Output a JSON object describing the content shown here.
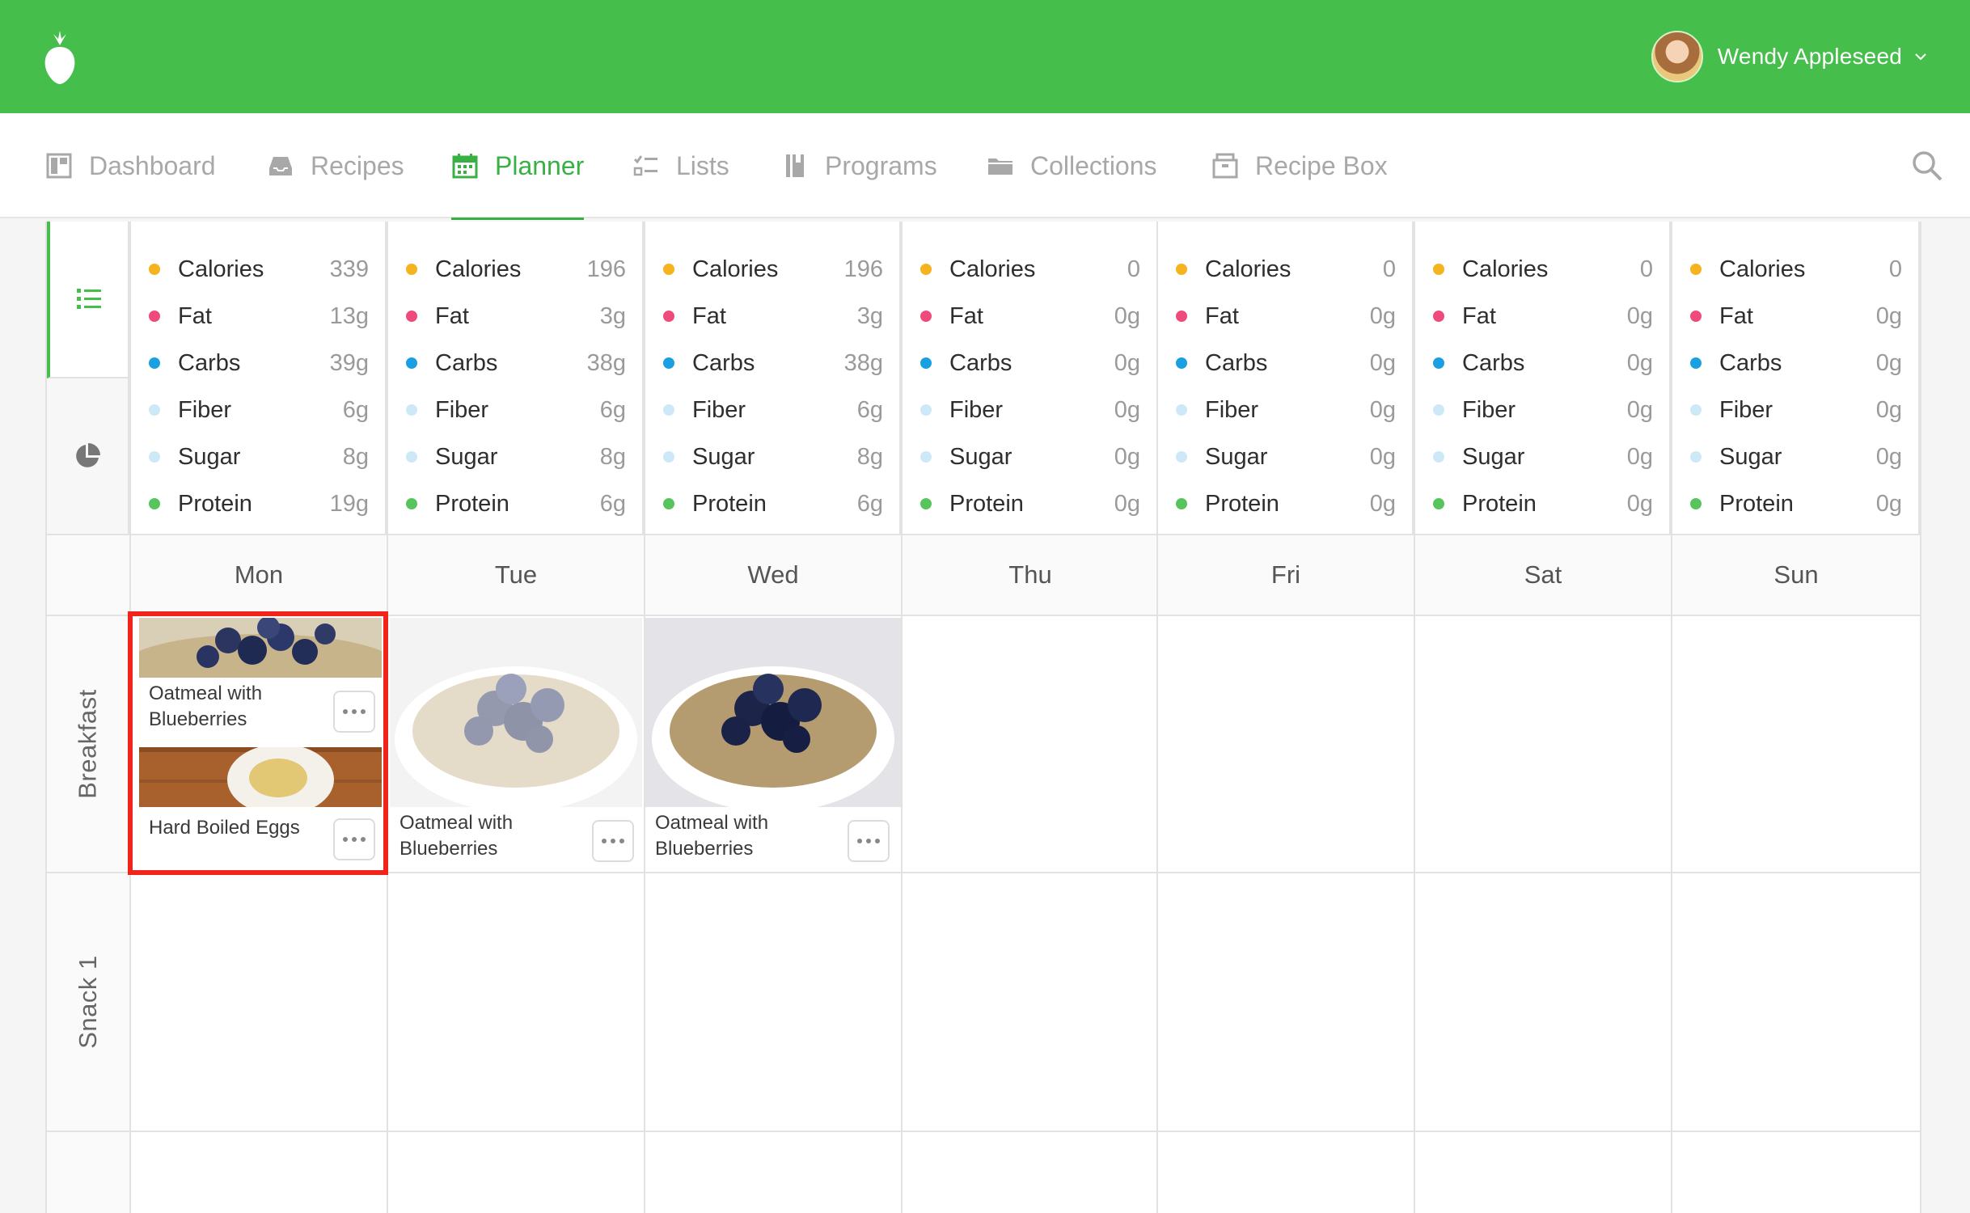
{
  "header": {
    "user_name": "Wendy Appleseed",
    "accent": "#45be4b",
    "logo_icon": "strawberry-logo-icon",
    "avatar_icon": "user-avatar"
  },
  "nav": {
    "items": [
      {
        "label": "Dashboard",
        "icon": "dashboard-icon"
      },
      {
        "label": "Recipes",
        "icon": "tray-icon"
      },
      {
        "label": "Planner",
        "icon": "calendar-icon",
        "active": true
      },
      {
        "label": "Lists",
        "icon": "checklist-icon"
      },
      {
        "label": "Programs",
        "icon": "book-icon"
      },
      {
        "label": "Collections",
        "icon": "folder-icon"
      },
      {
        "label": "Recipe Box",
        "icon": "box-icon"
      }
    ],
    "search_icon": "search-icon"
  },
  "side_tabs": [
    {
      "icon": "list-icon",
      "active": true
    },
    {
      "icon": "pie-chart-icon",
      "active": false
    }
  ],
  "nutrients": {
    "labels": [
      "Calories",
      "Fat",
      "Carbs",
      "Fiber",
      "Sugar",
      "Protein"
    ],
    "colors": [
      "#f5b320",
      "#ee4a7b",
      "#1aa0e0",
      "#cde9f7",
      "#cde9f7",
      "#58c45e"
    ],
    "days": [
      {
        "values": [
          "339",
          "13g",
          "39g",
          "6g",
          "8g",
          "19g"
        ]
      },
      {
        "values": [
          "196",
          "3g",
          "38g",
          "6g",
          "8g",
          "6g"
        ]
      },
      {
        "values": [
          "196",
          "3g",
          "38g",
          "6g",
          "8g",
          "6g"
        ]
      },
      {
        "values": [
          "0",
          "0g",
          "0g",
          "0g",
          "0g",
          "0g"
        ]
      },
      {
        "values": [
          "0",
          "0g",
          "0g",
          "0g",
          "0g",
          "0g"
        ]
      },
      {
        "values": [
          "0",
          "0g",
          "0g",
          "0g",
          "0g",
          "0g"
        ]
      },
      {
        "values": [
          "0",
          "0g",
          "0g",
          "0g",
          "0g",
          "0g"
        ]
      }
    ]
  },
  "days": [
    "Mon",
    "Tue",
    "Wed",
    "Thu",
    "Fri",
    "Sat",
    "Sun"
  ],
  "meals": [
    "Breakfast",
    "Snack 1"
  ],
  "breakfast": {
    "mon": [
      {
        "title_line1": "Oatmeal with",
        "title_line2": "Blueberries"
      },
      {
        "title_line1": "Hard Boiled Eggs",
        "title_line2": ""
      }
    ],
    "tue": {
      "title_line1": "Oatmeal with",
      "title_line2": "Blueberries"
    },
    "wed": {
      "title_line1": "Oatmeal with",
      "title_line2": "Blueberries"
    }
  },
  "selection_color": "#f0241b"
}
